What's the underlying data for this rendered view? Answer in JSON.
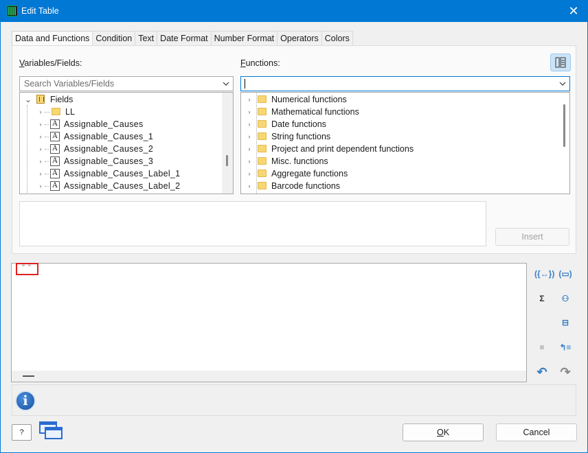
{
  "window": {
    "title": "Edit Table",
    "close_glyph": "✕"
  },
  "tabs": [
    {
      "label": "Data and Functions"
    },
    {
      "label": "Condition"
    },
    {
      "label": "Text"
    },
    {
      "label": "Date Format"
    },
    {
      "label": "Number Format"
    },
    {
      "label": "Operators"
    },
    {
      "label": "Colors"
    }
  ],
  "variables": {
    "label_first": "V",
    "label_rest": "ariables/Fields:",
    "search_placeholder": "Search Variables/Fields",
    "tree": [
      {
        "label": "Fields",
        "expander": "⌄",
        "icon": "fields-icon"
      },
      {
        "label": "LL",
        "expander": "›",
        "icon": "folder-icon"
      },
      {
        "label": "Assignable_Causes",
        "expander": "›",
        "icon": "text-field-icon"
      },
      {
        "label": "Assignable_Causes_1",
        "expander": "›",
        "icon": "text-field-icon"
      },
      {
        "label": "Assignable_Causes_2",
        "expander": "›",
        "icon": "text-field-icon"
      },
      {
        "label": "Assignable_Causes_3",
        "expander": "›",
        "icon": "text-field-icon"
      },
      {
        "label": "Assignable_Causes_Label_1",
        "expander": "›",
        "icon": "text-field-icon"
      },
      {
        "label": "Assignable_Causes_Label_2",
        "expander": "›",
        "icon": "text-field-icon"
      }
    ]
  },
  "functions": {
    "label_first": "F",
    "label_rest": "unctions:",
    "search_value": "",
    "items": [
      {
        "label": "Numerical functions"
      },
      {
        "label": "Mathematical functions"
      },
      {
        "label": "Date functions"
      },
      {
        "label": "String functions"
      },
      {
        "label": "Project and print dependent functions"
      },
      {
        "label": "Misc. functions"
      },
      {
        "label": "Aggregate functions"
      },
      {
        "label": "Barcode functions"
      }
    ]
  },
  "insert_button": {
    "label": "Insert"
  },
  "editor": {
    "content": "\" \""
  },
  "side_toolbar": {
    "icons": [
      "({↔})",
      "(▭)",
      "Σ",
      "⚇",
      "⊟",
      "≡",
      "↰≡",
      "↶",
      "↷"
    ]
  },
  "buttons": {
    "ok_first": "O",
    "ok_rest": "K",
    "cancel": "Cancel",
    "help_glyph": "?"
  },
  "colors": {
    "accent": "#0078d4",
    "highlight": "#e02020"
  }
}
